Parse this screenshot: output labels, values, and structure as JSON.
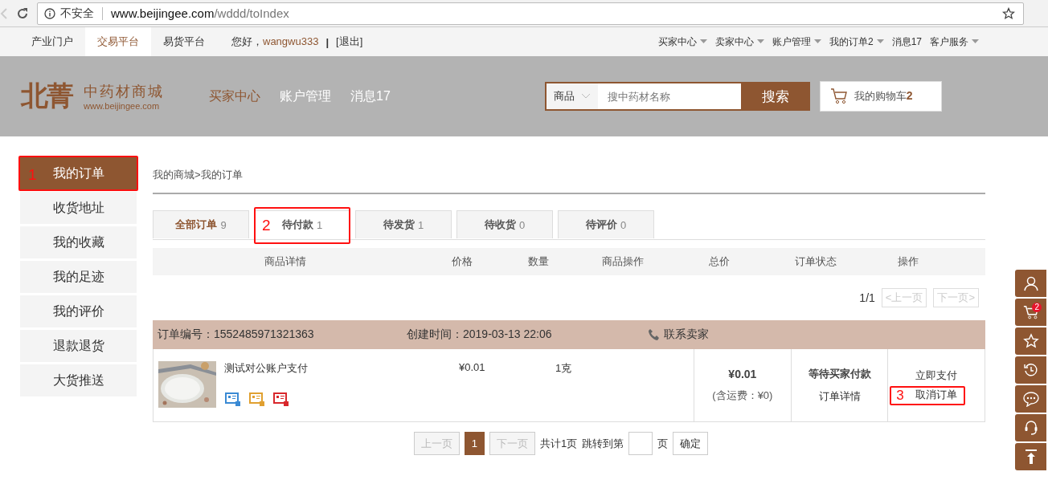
{
  "browser": {
    "security": "不安全",
    "url_host": "www.beijingee.com",
    "url_path": "/wddd/toIndex"
  },
  "topbar": {
    "left_links": [
      {
        "label": "产业门户",
        "selected": false
      },
      {
        "label": "交易平台",
        "selected": true
      },
      {
        "label": "易货平台",
        "selected": false
      }
    ],
    "greeting": "您好，",
    "username": "wangwu333",
    "separator": "|",
    "logout": "[退出]",
    "right_menus": [
      {
        "label": "买家中心",
        "dropdown": true
      },
      {
        "label": "卖家中心",
        "dropdown": true
      },
      {
        "label": "账户管理",
        "dropdown": true
      },
      {
        "label": "我的订单2",
        "dropdown": true
      },
      {
        "label": "消息17",
        "dropdown": false
      },
      {
        "label": "客户服务",
        "dropdown": true
      }
    ]
  },
  "header": {
    "logo_mark": "北菁",
    "logo_name": "中药材商城",
    "logo_url": "www.beijingee.com",
    "nav": [
      {
        "label": "买家中心",
        "selected": true
      },
      {
        "label": "账户管理",
        "selected": false
      },
      {
        "label": "消息17",
        "selected": false
      }
    ],
    "search": {
      "category": "商品",
      "placeholder": "搜中药材名称",
      "button": "搜索"
    },
    "cart": {
      "label": "我的购物车",
      "count": "2"
    }
  },
  "sidebar": {
    "items": [
      {
        "label": "我的订单",
        "selected": true,
        "annotation": "1"
      },
      {
        "label": "收货地址",
        "selected": false
      },
      {
        "label": "我的收藏",
        "selected": false
      },
      {
        "label": "我的足迹",
        "selected": false
      },
      {
        "label": "我的评价",
        "selected": false
      },
      {
        "label": "退款退货",
        "selected": false
      },
      {
        "label": "大货推送",
        "selected": false
      }
    ]
  },
  "breadcrumb": "我的商城>我的订单",
  "tabs": [
    {
      "label": "全部订单",
      "count": "9",
      "selected": true
    },
    {
      "label": "待付款",
      "count": "1",
      "selected": false,
      "annotation": "2"
    },
    {
      "label": "待发货",
      "count": "1",
      "selected": false
    },
    {
      "label": "待收货",
      "count": "0",
      "selected": false
    },
    {
      "label": "待评价",
      "count": "0",
      "selected": false
    }
  ],
  "table": {
    "columns": [
      "商品详情",
      "价格",
      "数量",
      "商品操作",
      "总价",
      "订单状态",
      "操作"
    ]
  },
  "pager_top": {
    "page": "1/1",
    "prev": "<上一页",
    "next": "下一页>",
    "disabled": true
  },
  "order": {
    "number_label": "订单编号：",
    "number": "1552485971321363",
    "created_label": "创建时间：",
    "created": "2019-03-13 22:06",
    "contact": "联系卖家",
    "item": {
      "name": "测试对公账户支付",
      "price": "¥0.01",
      "quantity": "1克",
      "badges": [
        {
          "color": "#3a8ad4"
        },
        {
          "color": "#e0a030"
        },
        {
          "color": "#d8282c"
        }
      ]
    },
    "total": "¥0.01",
    "shipping": "(含运费：¥0)",
    "status": "等待买家付款",
    "detail": "订单详情",
    "actions": [
      {
        "label": "立即支付"
      },
      {
        "label": "取消订单",
        "annotation": "3"
      }
    ]
  },
  "pagination": {
    "prev": "上一页",
    "pages": [
      {
        "label": "1",
        "selected": true
      }
    ],
    "next": "下一页",
    "total": "共计1页",
    "jump": "跳转到第",
    "unit": "页",
    "confirm": "确定"
  },
  "float_bar": {
    "cart_count": "2"
  }
}
